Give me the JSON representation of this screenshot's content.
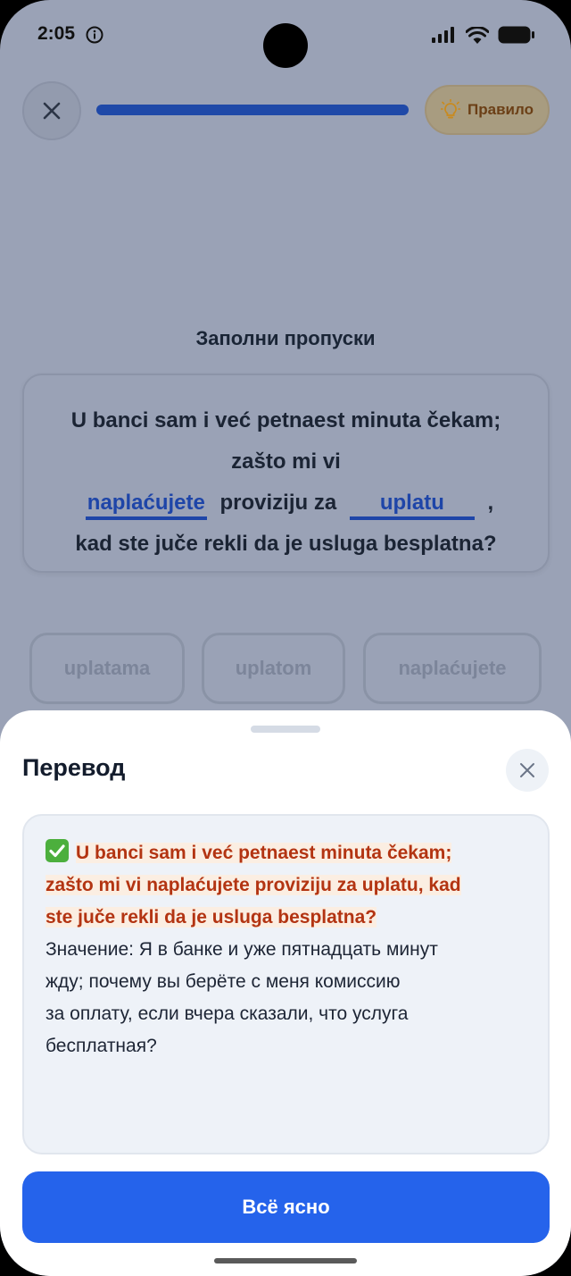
{
  "status_bar": {
    "time": "2:05",
    "icons": [
      "info-icon",
      "signal-icon",
      "wifi-icon",
      "battery-icon"
    ]
  },
  "header": {
    "close_icon": "close-icon",
    "progress": 1.0,
    "rule_button": {
      "icon": "lightbulb-icon",
      "label": "Правило"
    }
  },
  "exercise": {
    "title": "Заполни пропуски",
    "sentence": {
      "line1": "U banci sam i već petnaest minuta čekam;",
      "line2": "zašto mi vi",
      "blank1": "naplaćujete",
      "middle": "proviziju za",
      "blank2": "uplatu",
      "comma": ",",
      "line4": "kad ste juče rekli da je usluga besplatna?"
    },
    "choices": [
      "uplatama",
      "uplatom",
      "naplaćujete"
    ]
  },
  "sheet": {
    "title": "Перевод",
    "close_icon": "close-icon",
    "original_line1": "U banci sam i već petnaest minuta čekam;",
    "original_line2": "zašto mi vi naplaćujete proviziju za uplatu, kad",
    "original_line3": "ste juče rekli da je usluga besplatna?",
    "meaning_line1": "Значение: Я в банке и уже пятнадцать минут",
    "meaning_line2": "жду; почему вы берёте с меня комиссию",
    "meaning_line3": "за оплату, если вчера сказали, что услуга",
    "meaning_line4": "бесплатная?",
    "button": "Всё ясно"
  },
  "colors": {
    "accent": "#2563eb",
    "blank": "#1e45a8",
    "original_text": "#b33412",
    "check": "#4caf3d"
  }
}
